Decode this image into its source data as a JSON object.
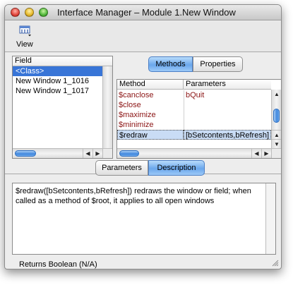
{
  "window": {
    "title": "Interface Manager – Module 1.New Window"
  },
  "toolbar": {
    "view_label": "View",
    "view_icon": "view-grid-icon"
  },
  "field_list": {
    "header": "Field",
    "items": [
      "<Class>",
      "New Window 1_1016",
      "New Window 1_1017"
    ],
    "selected_index": 0
  },
  "top_tabs": [
    "Methods",
    "Properties"
  ],
  "top_tabs_active": "Methods",
  "methods": {
    "columns": [
      "Method",
      "Parameters"
    ],
    "rows": [
      {
        "name": "$canclose",
        "params": "bQuit"
      },
      {
        "name": "$close",
        "params": ""
      },
      {
        "name": "$maximize",
        "params": ""
      },
      {
        "name": "$minimize",
        "params": ""
      },
      {
        "name": "$redraw",
        "params": "[bSetcontents,bRefresh]"
      }
    ],
    "selected_index": 4
  },
  "bottom_tabs": [
    "Parameters",
    "Description"
  ],
  "bottom_tabs_active": "Description",
  "description": {
    "text": "$redraw([bSetcontents,bRefresh]) redraws the window or field; when called as a method of $root, it applies to all open windows"
  },
  "status": {
    "text": "Returns Boolean (N/A)"
  },
  "colors": {
    "accent": "#3875d7",
    "method_text": "#8b1414",
    "tab_active": "#6aa7ec"
  }
}
